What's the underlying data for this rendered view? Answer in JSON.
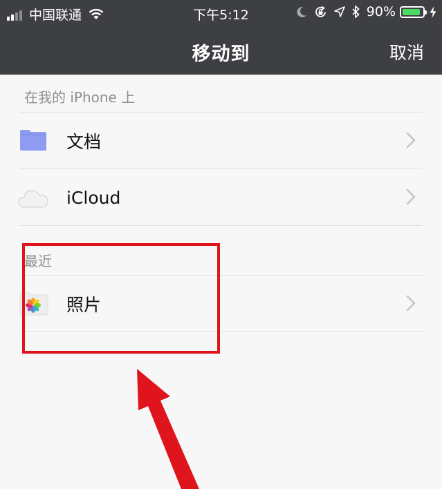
{
  "status_bar": {
    "carrier": "中国联通",
    "time": "下午5:12",
    "battery_text": "90%",
    "battery_level": 0.9
  },
  "nav": {
    "title": "移动到",
    "cancel_label": "取消"
  },
  "sections": [
    {
      "header": "在我的 iPhone 上",
      "items": [
        {
          "label": "文档",
          "icon": "folder-icon"
        },
        {
          "label": "iCloud",
          "icon": "cloud-icon"
        }
      ]
    },
    {
      "header": "最近",
      "items": [
        {
          "label": "照片",
          "icon": "photos-icon"
        }
      ]
    }
  ],
  "colors": {
    "nav_background": "#3d3f42",
    "page_background": "#f7f7f7",
    "folder_blue": "#8e9bf0",
    "battery_green": "#4cd964",
    "annotation_red": "#e0141c"
  }
}
